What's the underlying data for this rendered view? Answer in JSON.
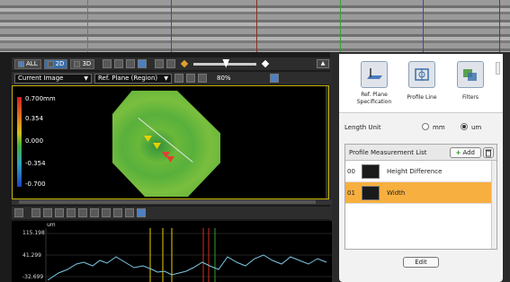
{
  "toolbar": {
    "all_label": "ALL",
    "twod_label": "2D",
    "threed_label": "3D",
    "eject_label": "▲"
  },
  "view_controls": {
    "image_select": "Current Image",
    "plane_select": "Ref. Plane (Region)",
    "zoom": "80%"
  },
  "color_scale": {
    "labels": [
      "0.700mm",
      "0.354",
      "0.000",
      "-0.354",
      "-0.700"
    ]
  },
  "profile_chart": {
    "unit": "um",
    "y_labels": [
      "115.198",
      "41.299",
      "-32.699"
    ]
  },
  "spec": {
    "ref_plane_label": "Ref. Plane Specification",
    "profile_line_label": "Profile Line",
    "filters_label": "Filters"
  },
  "length_unit": {
    "label": "Length Unit",
    "options": [
      "mm",
      "um"
    ],
    "selected": "um"
  },
  "measurement_list": {
    "title": "Profile Measurement List",
    "add_label": "Add",
    "items": [
      {
        "index": "00",
        "name": "Height Difference"
      },
      {
        "index": "01",
        "name": "Width"
      }
    ],
    "selected_index": "01"
  },
  "edit_label": "Edit",
  "colors": {
    "accent_orange": "#f7b040",
    "view_border": "#c8b400",
    "profile_line": "#7ec8e3"
  }
}
